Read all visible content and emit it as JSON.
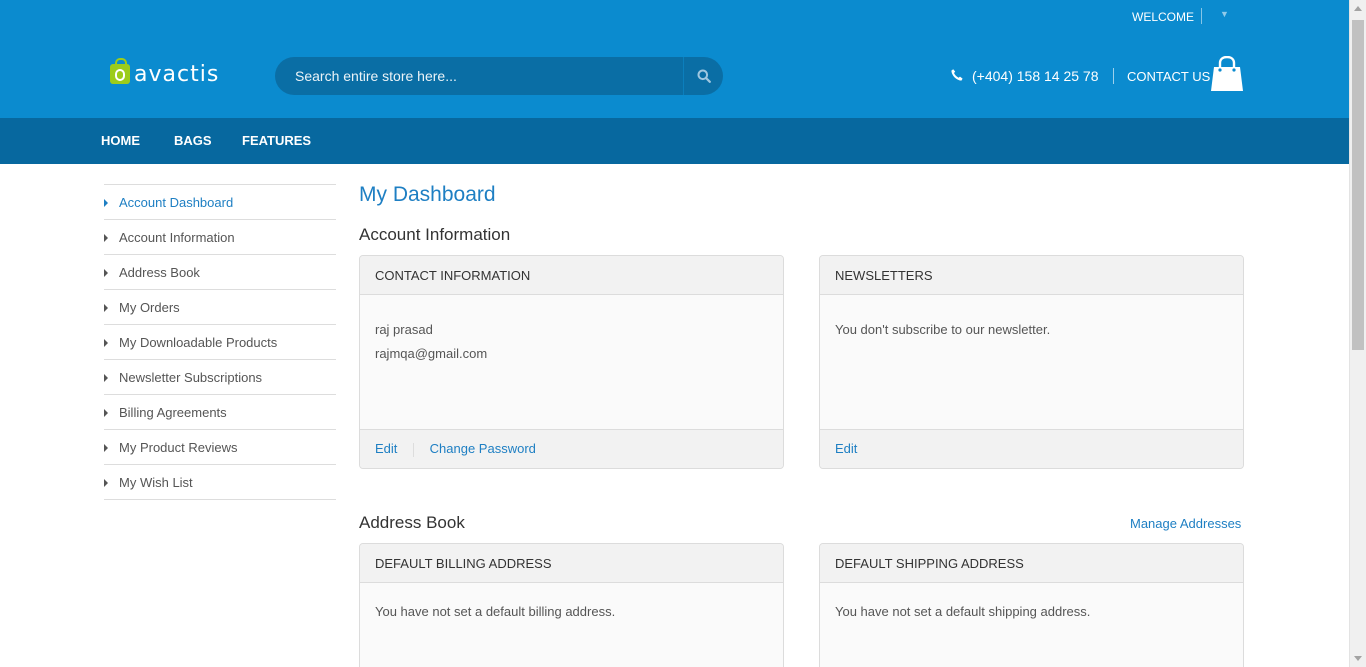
{
  "topbar": {
    "welcome": "WELCOME"
  },
  "header": {
    "logo_text": "avactis",
    "search_placeholder": "Search entire store here...",
    "phone": "(+404) 158 14 25 78",
    "contact": "CONTACT US"
  },
  "nav": {
    "items": [
      "HOME",
      "BAGS",
      "FEATURES"
    ]
  },
  "sidebar": {
    "items": [
      {
        "label": "Account Dashboard",
        "active": true
      },
      {
        "label": "Account Information"
      },
      {
        "label": "Address Book"
      },
      {
        "label": "My Orders"
      },
      {
        "label": "My Downloadable Products"
      },
      {
        "label": "Newsletter Subscriptions"
      },
      {
        "label": "Billing Agreements"
      },
      {
        "label": "My Product Reviews"
      },
      {
        "label": "My Wish List"
      }
    ]
  },
  "main": {
    "title": "My Dashboard",
    "account_section": "Account Information",
    "contact_box": {
      "title": "CONTACT INFORMATION",
      "name": "raj prasad",
      "email": "rajmqa@gmail.com",
      "edit": "Edit",
      "change_password": "Change Password"
    },
    "newsletter_box": {
      "title": "NEWSLETTERS",
      "text": "You don't subscribe to our newsletter.",
      "edit": "Edit"
    },
    "address_section": "Address Book",
    "manage_addresses": "Manage Addresses",
    "billing_box": {
      "title": "DEFAULT BILLING ADDRESS",
      "text": "You have not set a default billing address."
    },
    "shipping_box": {
      "title": "DEFAULT SHIPPING ADDRESS",
      "text": "You have not set a default shipping address."
    }
  },
  "colors": {
    "header": "#0b8bcf",
    "nav": "#07689f",
    "link": "#1e7fc3",
    "logo_accent": "#9ccc1a"
  }
}
